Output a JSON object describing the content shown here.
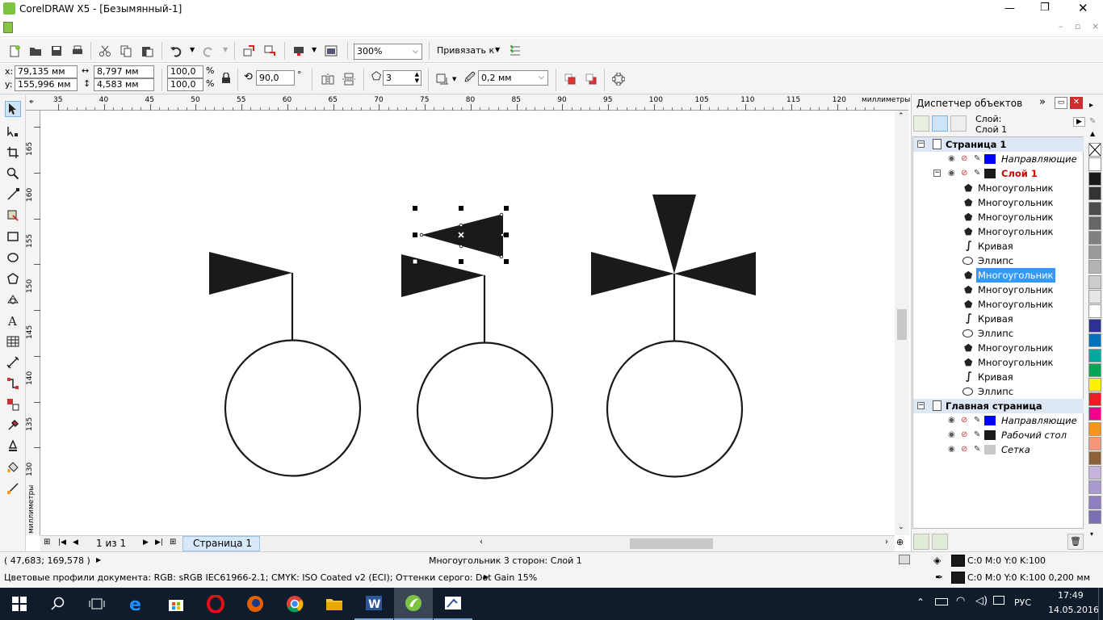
{
  "window": {
    "title": "CorelDRAW X5 - [Безымянный-1]"
  },
  "standard_toolbar": {
    "zoom": "300%",
    "snap_label": "Привязать к"
  },
  "property_bar": {
    "x_label": "x:",
    "x": "79,135 мм",
    "y_label": "y:",
    "y": "155,996 мм",
    "width": "8,797 мм",
    "height": "4,583 мм",
    "scale_x": "100,0",
    "scale_y": "100,0",
    "percent": "%",
    "angle": "90,0",
    "degree": "°",
    "sides": "3",
    "outline_width": "0,2 мм"
  },
  "ruler": {
    "h_ticks": [
      "35",
      "40",
      "45",
      "50",
      "55",
      "60",
      "65",
      "70",
      "75",
      "80",
      "85",
      "90",
      "95",
      "100",
      "105",
      "110",
      "115",
      "120"
    ],
    "h_unit": "миллиметры",
    "v_ticks": [
      "165",
      "160",
      "155",
      "150",
      "145",
      "140",
      "135",
      "130"
    ],
    "v_unit": "миллиметры"
  },
  "page_nav": {
    "counter": "1 из 1",
    "tab": "Страница 1"
  },
  "docker": {
    "title": "Диспетчер объектов",
    "layer_label": "Слой:",
    "layer_name": "Слой 1",
    "tree": [
      {
        "text": "Страница 1",
        "kind": "page"
      },
      {
        "text": "Направляющие",
        "kind": "layer",
        "color": "#0000ff",
        "italic": true
      },
      {
        "text": "Слой 1",
        "kind": "layer-active",
        "color": "#1a1a1a"
      },
      {
        "text": "Многоугольник",
        "kind": "polygon"
      },
      {
        "text": "Многоугольник",
        "kind": "polygon"
      },
      {
        "text": "Многоугольник",
        "kind": "polygon"
      },
      {
        "text": "Многоугольник",
        "kind": "polygon"
      },
      {
        "text": "Кривая",
        "kind": "curve"
      },
      {
        "text": "Эллипс",
        "kind": "ellipse"
      },
      {
        "text": "Многоугольник",
        "kind": "polygon",
        "selected": true
      },
      {
        "text": "Многоугольник",
        "kind": "polygon"
      },
      {
        "text": "Многоугольник",
        "kind": "polygon"
      },
      {
        "text": "Кривая",
        "kind": "curve"
      },
      {
        "text": "Эллипс",
        "kind": "ellipse"
      },
      {
        "text": "Многоугольник",
        "kind": "polygon"
      },
      {
        "text": "Многоугольник",
        "kind": "polygon"
      },
      {
        "text": "Кривая",
        "kind": "curve"
      },
      {
        "text": "Эллипс",
        "kind": "ellipse"
      },
      {
        "text": "Главная страница",
        "kind": "page"
      },
      {
        "text": "Направляющие",
        "kind": "layer",
        "color": "#0000ff",
        "italic": true
      },
      {
        "text": "Рабочий стол",
        "kind": "layer",
        "color": "#1a1a1a",
        "italic": true
      },
      {
        "text": "Сетка",
        "kind": "layer",
        "color": "#c8c8c8",
        "italic": true
      }
    ]
  },
  "palette": [
    "#ffffff",
    "#1a1a1a",
    "#333333",
    "#4d4d4d",
    "#666666",
    "#808080",
    "#999999",
    "#b3b3b3",
    "#cccccc",
    "#e6e6e6",
    "#ffffff",
    "#2e3192",
    "#0072bc",
    "#00a99d",
    "#00a651",
    "#fff200",
    "#ed1c24",
    "#ec008c",
    "#f7941d",
    "#f69679",
    "#8c6239",
    "#c7b2de",
    "#a99ad0",
    "#8f7ec2",
    "#7a6fb2"
  ],
  "status": {
    "coords": "( 47,683; 169,578 )",
    "object_info": "Многоугольник  3 сторон: Слой 1",
    "color_profiles": "Цветовые профили документа: RGB: sRGB IEC61966-2.1; CMYK: ISO Coated v2 (ECI); Оттенки серого: Dot Gain 15%",
    "fill": "C:0 M:0 Y:0 K:100",
    "outline": "C:0 M:0 Y:0 K:100  0,200 мм"
  },
  "taskbar": {
    "lang": "РУС",
    "time": "17:49",
    "date": "14.05.2016"
  },
  "colors": {
    "selection": "#3399ff",
    "active_layer": "#d40000",
    "taskbar": "#101c2c"
  }
}
